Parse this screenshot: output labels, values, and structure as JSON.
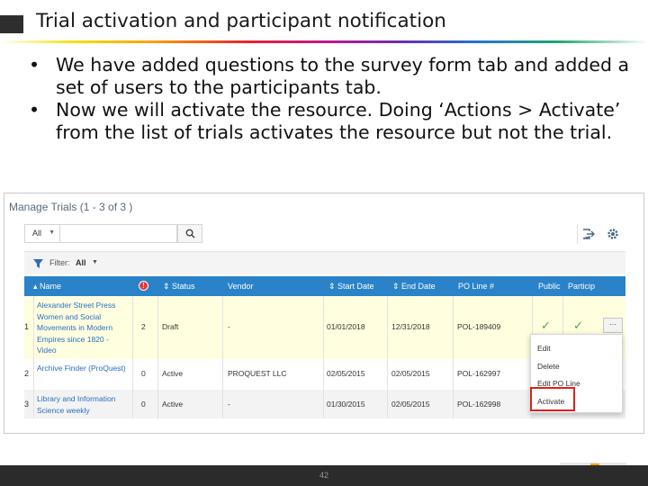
{
  "slide": {
    "title": "Trial activation and participant notification",
    "bullets": [
      "We have added questions to the survey form tab and added a set of users to the participants tab.",
      "Now we will activate the resource.  Doing ‘Actions > Activate’ from the list of trials activates the resource but not the trial."
    ],
    "page_number": "42"
  },
  "screenshot": {
    "title": "Manage Trials (1 - 3 of 3 )",
    "toolbar": {
      "scope_select": "All",
      "search_value": "",
      "icons": [
        "search-icon",
        "export-icon",
        "gear-icon"
      ]
    },
    "filter": {
      "label": "Filter:",
      "value": "All"
    },
    "columns": {
      "name": "Name",
      "status": "Status",
      "vendor": "Vendor",
      "start_date": "Start Date",
      "end_date": "End Date",
      "po_line": "PO Line #",
      "public": "Public",
      "participants": "Particip"
    },
    "rows": [
      {
        "num": "1",
        "name": "Alexander Street Press Women and Social Movements in Modern Empires since 1820 - Video",
        "warnings": "2",
        "status": "Draft",
        "vendor": "-",
        "start_date": "01/01/2018",
        "end_date": "12/31/2018",
        "po_line": "POL-189409"
      },
      {
        "num": "2",
        "name": "Archive Finder (ProQuest)",
        "warnings": "0",
        "status": "Active",
        "vendor": "PROQUEST LLC",
        "start_date": "02/05/2015",
        "end_date": "02/05/2015",
        "po_line": "POL-162997"
      },
      {
        "num": "3",
        "name": "Library and Information Science weekly",
        "warnings": "0",
        "status": "Active",
        "vendor": "-",
        "start_date": "01/30/2015",
        "end_date": "02/05/2015",
        "po_line": "POL-162998"
      }
    ],
    "row_actions_button": "···",
    "actions_menu": [
      "Edit",
      "Delete",
      "Edit PO Line",
      "Activate"
    ],
    "colors": {
      "header_blue": "#2a82c9",
      "highlight_row": "#ffffe0",
      "highlight_border": "#e0201c",
      "check_green": "#49a54d"
    }
  }
}
